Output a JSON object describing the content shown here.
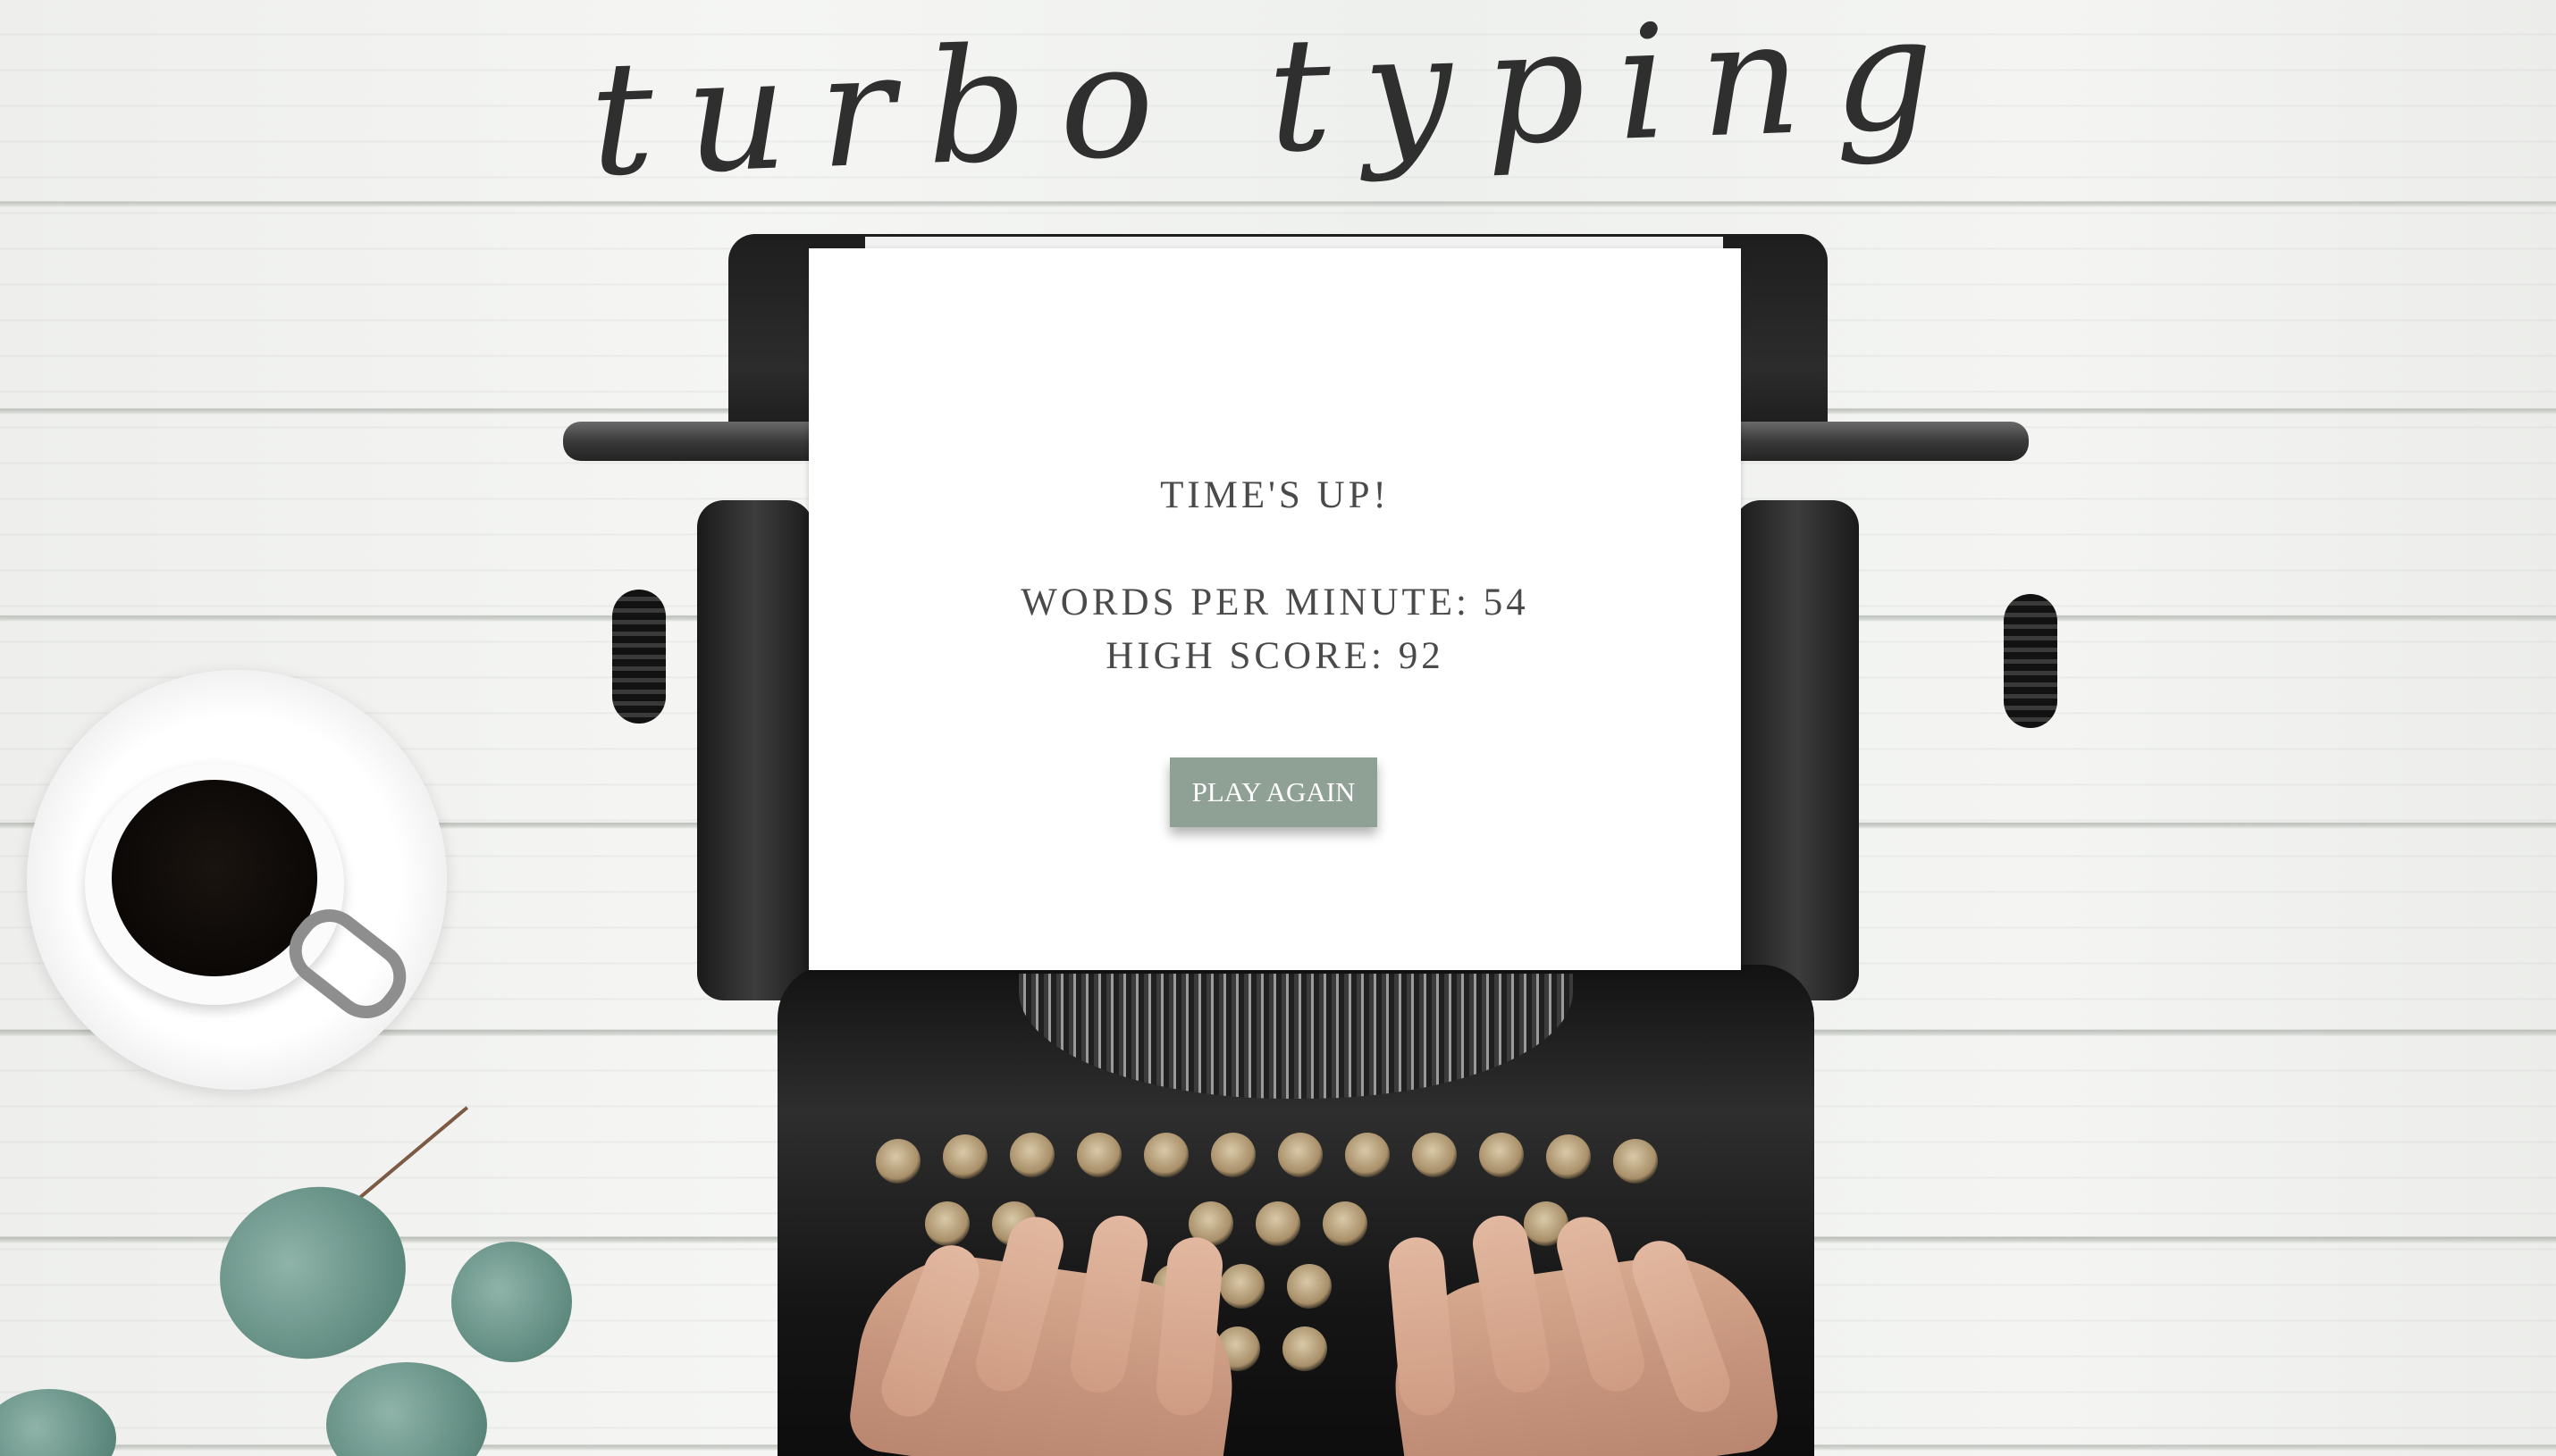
{
  "app": {
    "title": "turbo typing"
  },
  "dialog": {
    "status": "TIME'S UP!",
    "wpm_label": "WORDS PER MINUTE:",
    "wpm_value": "54",
    "high_score_label": "HIGH SCORE:",
    "high_score_value": "92",
    "play_again_label": "PLAY AGAIN"
  },
  "colors": {
    "button": "#8fa095",
    "text": "#4a4a4a",
    "paper": "#ffffff"
  },
  "background": {
    "scene": [
      "typewriter",
      "coffee-cup",
      "eucalyptus-leaves",
      "hands",
      "white-wood-planks"
    ]
  }
}
